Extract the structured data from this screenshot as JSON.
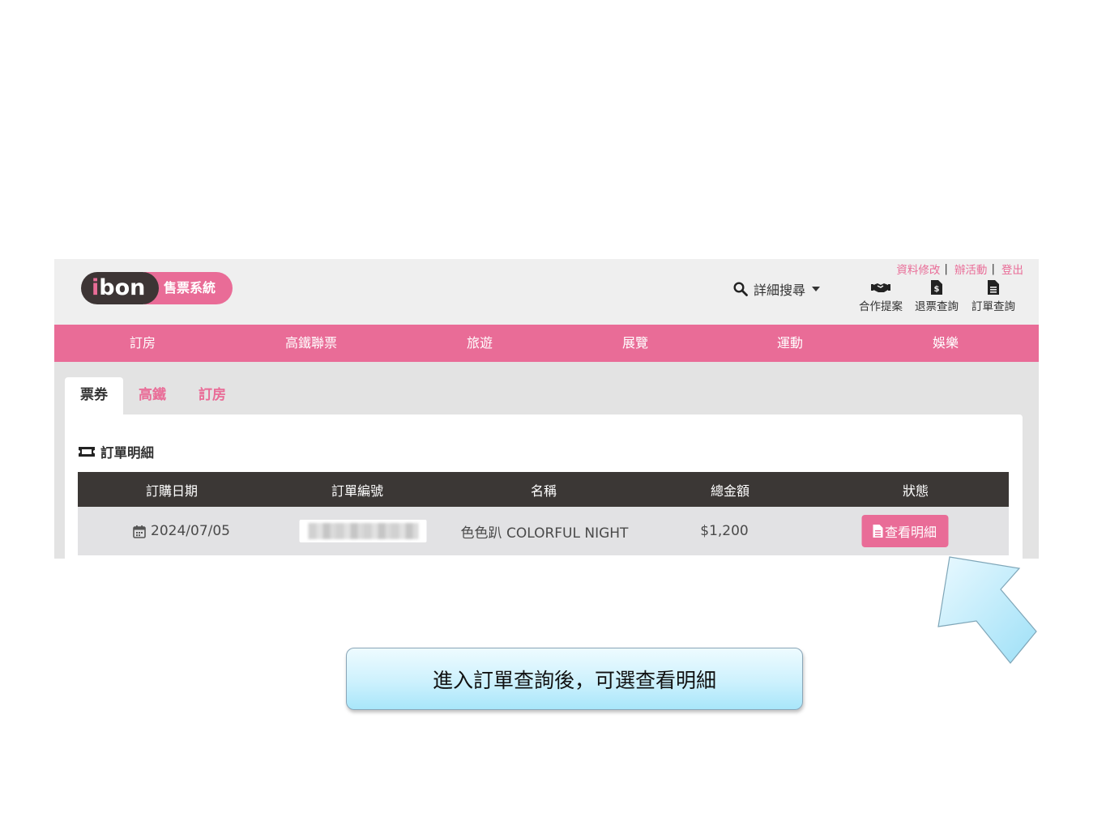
{
  "logo": {
    "brand": "bon",
    "brand_i": "i",
    "system": "售票系統"
  },
  "search": {
    "label": "詳細搜尋"
  },
  "top_links": [
    "資料修改",
    "辦活動",
    "登出"
  ],
  "quick_links": [
    {
      "label": "合作提案",
      "icon": "handshake-icon"
    },
    {
      "label": "退票查詢",
      "icon": "refund-doc-icon"
    },
    {
      "label": "訂單查詢",
      "icon": "order-doc-icon"
    }
  ],
  "nav": [
    "訂房",
    "高鐵聯票",
    "旅遊",
    "展覽",
    "運動",
    "娛樂"
  ],
  "tabs": [
    "票券",
    "高鐵",
    "訂房"
  ],
  "section": {
    "title": "訂單明細",
    "icon": "ticket-icon"
  },
  "table": {
    "headers": [
      "訂購日期",
      "訂單編號",
      "名稱",
      "總金額",
      "狀態"
    ],
    "rows": [
      {
        "date": "2024/07/05",
        "order_no": "",
        "name": "色色趴 COLORFUL NIGHT",
        "amount": "$1,200",
        "action": "查看明細"
      }
    ]
  },
  "callout": {
    "text": "進入訂單查詢後，可選查看明細"
  },
  "colors": {
    "brand_pink": "#e96c97",
    "dark": "#3b3735",
    "callout": "#cdf1fd"
  }
}
